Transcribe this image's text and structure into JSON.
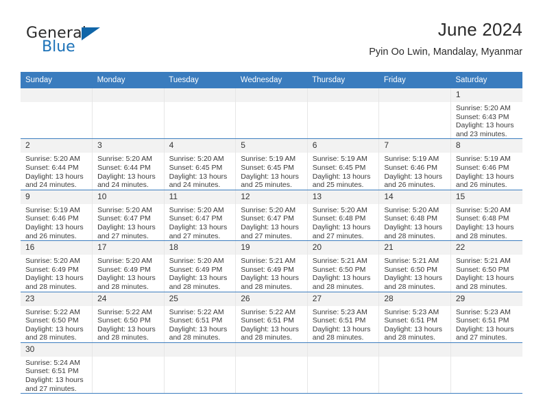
{
  "brand": {
    "name_top": "General",
    "name_bottom": "Blue",
    "triangle_color": "#1065a8",
    "blue_color": "#1c72b8"
  },
  "header": {
    "title": "June 2024",
    "subtitle": "Pyin Oo Lwin, Mandalay, Myanmar"
  },
  "theme": {
    "header_blue": "#3a7cbe",
    "daynum_bg": "#f2f2f2",
    "row_divider": "#3a7cbe",
    "cell_divider": "#e6e6e6"
  },
  "weekday_headers": [
    "Sunday",
    "Monday",
    "Tuesday",
    "Wednesday",
    "Thursday",
    "Friday",
    "Saturday"
  ],
  "weeks": [
    [
      {
        "day": "",
        "empty": true,
        "lines": []
      },
      {
        "day": "",
        "empty": true,
        "lines": []
      },
      {
        "day": "",
        "empty": true,
        "lines": []
      },
      {
        "day": "",
        "empty": true,
        "lines": []
      },
      {
        "day": "",
        "empty": true,
        "lines": []
      },
      {
        "day": "",
        "empty": true,
        "lines": []
      },
      {
        "day": "1",
        "empty": false,
        "lines": [
          "Sunrise: 5:20 AM",
          "Sunset: 6:43 PM",
          "Daylight: 13 hours",
          "and 23 minutes."
        ]
      }
    ],
    [
      {
        "day": "2",
        "empty": false,
        "lines": [
          "Sunrise: 5:20 AM",
          "Sunset: 6:44 PM",
          "Daylight: 13 hours",
          "and 24 minutes."
        ]
      },
      {
        "day": "3",
        "empty": false,
        "lines": [
          "Sunrise: 5:20 AM",
          "Sunset: 6:44 PM",
          "Daylight: 13 hours",
          "and 24 minutes."
        ]
      },
      {
        "day": "4",
        "empty": false,
        "lines": [
          "Sunrise: 5:20 AM",
          "Sunset: 6:45 PM",
          "Daylight: 13 hours",
          "and 24 minutes."
        ]
      },
      {
        "day": "5",
        "empty": false,
        "lines": [
          "Sunrise: 5:19 AM",
          "Sunset: 6:45 PM",
          "Daylight: 13 hours",
          "and 25 minutes."
        ]
      },
      {
        "day": "6",
        "empty": false,
        "lines": [
          "Sunrise: 5:19 AM",
          "Sunset: 6:45 PM",
          "Daylight: 13 hours",
          "and 25 minutes."
        ]
      },
      {
        "day": "7",
        "empty": false,
        "lines": [
          "Sunrise: 5:19 AM",
          "Sunset: 6:46 PM",
          "Daylight: 13 hours",
          "and 26 minutes."
        ]
      },
      {
        "day": "8",
        "empty": false,
        "lines": [
          "Sunrise: 5:19 AM",
          "Sunset: 6:46 PM",
          "Daylight: 13 hours",
          "and 26 minutes."
        ]
      }
    ],
    [
      {
        "day": "9",
        "empty": false,
        "lines": [
          "Sunrise: 5:19 AM",
          "Sunset: 6:46 PM",
          "Daylight: 13 hours",
          "and 26 minutes."
        ]
      },
      {
        "day": "10",
        "empty": false,
        "lines": [
          "Sunrise: 5:20 AM",
          "Sunset: 6:47 PM",
          "Daylight: 13 hours",
          "and 27 minutes."
        ]
      },
      {
        "day": "11",
        "empty": false,
        "lines": [
          "Sunrise: 5:20 AM",
          "Sunset: 6:47 PM",
          "Daylight: 13 hours",
          "and 27 minutes."
        ]
      },
      {
        "day": "12",
        "empty": false,
        "lines": [
          "Sunrise: 5:20 AM",
          "Sunset: 6:47 PM",
          "Daylight: 13 hours",
          "and 27 minutes."
        ]
      },
      {
        "day": "13",
        "empty": false,
        "lines": [
          "Sunrise: 5:20 AM",
          "Sunset: 6:48 PM",
          "Daylight: 13 hours",
          "and 27 minutes."
        ]
      },
      {
        "day": "14",
        "empty": false,
        "lines": [
          "Sunrise: 5:20 AM",
          "Sunset: 6:48 PM",
          "Daylight: 13 hours",
          "and 28 minutes."
        ]
      },
      {
        "day": "15",
        "empty": false,
        "lines": [
          "Sunrise: 5:20 AM",
          "Sunset: 6:48 PM",
          "Daylight: 13 hours",
          "and 28 minutes."
        ]
      }
    ],
    [
      {
        "day": "16",
        "empty": false,
        "lines": [
          "Sunrise: 5:20 AM",
          "Sunset: 6:49 PM",
          "Daylight: 13 hours",
          "and 28 minutes."
        ]
      },
      {
        "day": "17",
        "empty": false,
        "lines": [
          "Sunrise: 5:20 AM",
          "Sunset: 6:49 PM",
          "Daylight: 13 hours",
          "and 28 minutes."
        ]
      },
      {
        "day": "18",
        "empty": false,
        "lines": [
          "Sunrise: 5:20 AM",
          "Sunset: 6:49 PM",
          "Daylight: 13 hours",
          "and 28 minutes."
        ]
      },
      {
        "day": "19",
        "empty": false,
        "lines": [
          "Sunrise: 5:21 AM",
          "Sunset: 6:49 PM",
          "Daylight: 13 hours",
          "and 28 minutes."
        ]
      },
      {
        "day": "20",
        "empty": false,
        "lines": [
          "Sunrise: 5:21 AM",
          "Sunset: 6:50 PM",
          "Daylight: 13 hours",
          "and 28 minutes."
        ]
      },
      {
        "day": "21",
        "empty": false,
        "lines": [
          "Sunrise: 5:21 AM",
          "Sunset: 6:50 PM",
          "Daylight: 13 hours",
          "and 28 minutes."
        ]
      },
      {
        "day": "22",
        "empty": false,
        "lines": [
          "Sunrise: 5:21 AM",
          "Sunset: 6:50 PM",
          "Daylight: 13 hours",
          "and 28 minutes."
        ]
      }
    ],
    [
      {
        "day": "23",
        "empty": false,
        "lines": [
          "Sunrise: 5:22 AM",
          "Sunset: 6:50 PM",
          "Daylight: 13 hours",
          "and 28 minutes."
        ]
      },
      {
        "day": "24",
        "empty": false,
        "lines": [
          "Sunrise: 5:22 AM",
          "Sunset: 6:50 PM",
          "Daylight: 13 hours",
          "and 28 minutes."
        ]
      },
      {
        "day": "25",
        "empty": false,
        "lines": [
          "Sunrise: 5:22 AM",
          "Sunset: 6:51 PM",
          "Daylight: 13 hours",
          "and 28 minutes."
        ]
      },
      {
        "day": "26",
        "empty": false,
        "lines": [
          "Sunrise: 5:22 AM",
          "Sunset: 6:51 PM",
          "Daylight: 13 hours",
          "and 28 minutes."
        ]
      },
      {
        "day": "27",
        "empty": false,
        "lines": [
          "Sunrise: 5:23 AM",
          "Sunset: 6:51 PM",
          "Daylight: 13 hours",
          "and 28 minutes."
        ]
      },
      {
        "day": "28",
        "empty": false,
        "lines": [
          "Sunrise: 5:23 AM",
          "Sunset: 6:51 PM",
          "Daylight: 13 hours",
          "and 28 minutes."
        ]
      },
      {
        "day": "29",
        "empty": false,
        "lines": [
          "Sunrise: 5:23 AM",
          "Sunset: 6:51 PM",
          "Daylight: 13 hours",
          "and 27 minutes."
        ]
      }
    ],
    [
      {
        "day": "30",
        "empty": false,
        "lines": [
          "Sunrise: 5:24 AM",
          "Sunset: 6:51 PM",
          "Daylight: 13 hours",
          "and 27 minutes."
        ]
      },
      {
        "day": "",
        "empty": true,
        "lines": []
      },
      {
        "day": "",
        "empty": true,
        "lines": []
      },
      {
        "day": "",
        "empty": true,
        "lines": []
      },
      {
        "day": "",
        "empty": true,
        "lines": []
      },
      {
        "day": "",
        "empty": true,
        "lines": []
      },
      {
        "day": "",
        "empty": true,
        "lines": []
      }
    ]
  ]
}
